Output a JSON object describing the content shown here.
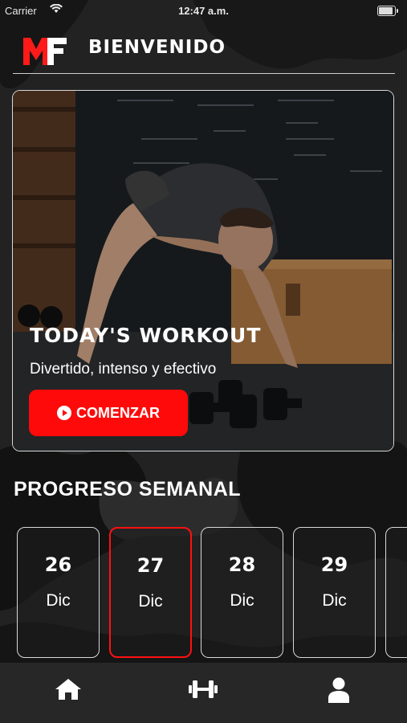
{
  "status_bar": {
    "carrier": "Carrier",
    "time": "12:47 a.m."
  },
  "header": {
    "logo_text": "MF",
    "title": "BIENVENIDO"
  },
  "hero": {
    "title": "TODAY'S WORKOUT",
    "subtitle": "Divertido, intenso y efectivo",
    "button_label": "COMENZAR"
  },
  "progress": {
    "title": "PROGRESO SEMANAL",
    "days": [
      {
        "day": "26",
        "month": "Dic",
        "selected": false
      },
      {
        "day": "27",
        "month": "Dic",
        "selected": true
      },
      {
        "day": "28",
        "month": "Dic",
        "selected": false
      },
      {
        "day": "29",
        "month": "Dic",
        "selected": false
      }
    ]
  },
  "tab_bar": {
    "icons": [
      "home-icon",
      "dumbbell-icon",
      "user-icon"
    ]
  },
  "colors": {
    "accent": "#ff0a0a",
    "background": "#202020",
    "tab_bar": "#272727"
  }
}
